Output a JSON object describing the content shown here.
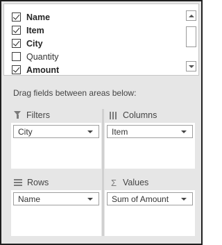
{
  "fields": [
    {
      "label": "Name",
      "checked": true,
      "bold": true
    },
    {
      "label": "Item",
      "checked": true,
      "bold": true
    },
    {
      "label": "City",
      "checked": true,
      "bold": true
    },
    {
      "label": "Quantity",
      "checked": false,
      "bold": false
    },
    {
      "label": "Amount",
      "checked": true,
      "bold": true
    }
  ],
  "drag_hint": "Drag fields between areas below:",
  "areas": {
    "filters": {
      "title": "Filters",
      "icon": "filter-icon",
      "field": "City"
    },
    "columns": {
      "title": "Columns",
      "icon": "columns-icon",
      "field": "Item"
    },
    "rows": {
      "title": "Rows",
      "icon": "rows-icon",
      "field": "Name"
    },
    "values": {
      "title": "Values",
      "icon": "sigma-icon",
      "sigma": "Σ",
      "field": "Sum of Amount"
    }
  }
}
